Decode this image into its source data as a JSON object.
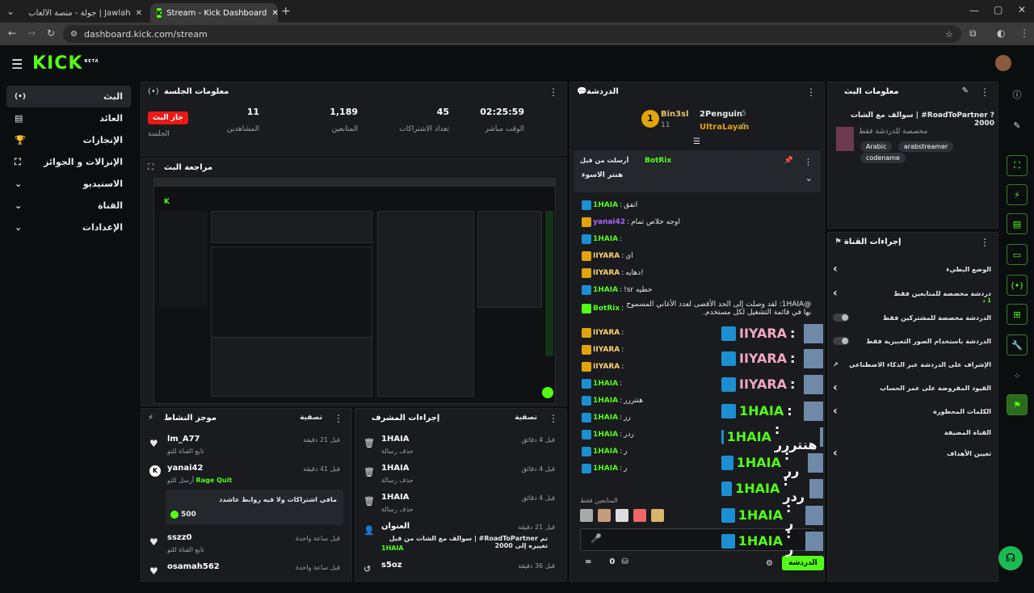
{
  "browser": {
    "tabs": [
      {
        "label": "Jawlah | جولة - منصة الألعاب الع",
        "active": false
      },
      {
        "label": "Stream - Kick Dashboard",
        "active": true
      }
    ],
    "url": "dashboard.kick.com/stream"
  },
  "logo": {
    "text": "KICK",
    "beta": "BETA"
  },
  "sidebar": {
    "items": [
      {
        "label": "البث",
        "icon": "live-icon",
        "active": true
      },
      {
        "label": "العائد",
        "icon": "wallet-icon",
        "active": false
      },
      {
        "label": "الإنجازات",
        "icon": "trophy-icon",
        "active": false
      },
      {
        "label": "الإنزالات و الجوائز",
        "icon": "drops-icon",
        "active": false
      },
      {
        "label": "الاستيديو",
        "icon": "studio-icon",
        "active": false
      },
      {
        "label": "القناة",
        "icon": "channel-icon",
        "active": false
      },
      {
        "label": "الإعدادات",
        "icon": "settings-icon",
        "active": false
      }
    ]
  },
  "session": {
    "title": "معلومات الجلسة",
    "live_badge": "جاز البث",
    "live_label": "الجلسة",
    "stats": [
      {
        "value": "02:25:59",
        "label": "الوقت مباشر"
      },
      {
        "value": "45",
        "label": "تعداد الاشتراكات"
      },
      {
        "value": "1,189",
        "label": "المتابعين"
      },
      {
        "value": "11",
        "label": "المشاهدين"
      }
    ]
  },
  "preview": {
    "title": "مراجعة البث"
  },
  "activity": {
    "title": "موجز النشاط",
    "filter": "تصفية",
    "items": [
      {
        "name": "lm_A77",
        "sub": "تابع القناة للتو",
        "time": "قبل 21 دقيقة"
      },
      {
        "name": "yanai42",
        "sub": "أرسل للتو",
        "highlight": "Rage Quit",
        "time": "قبل 41 دقيقة",
        "message": "مافي اشتراكات ولا فيه روابط عاشدد",
        "amount": "500"
      },
      {
        "name": "sszz0",
        "sub": "تابع القناة للتو",
        "time": "قبل ساعة واحدة"
      },
      {
        "name": "osamah562",
        "sub": "",
        "time": "قبل ساعة واحدة"
      }
    ]
  },
  "modactions": {
    "title": "إجراءات المشرف",
    "filter": "تصفية",
    "items": [
      {
        "name": "1HAIA",
        "sub": "حذف رسالة",
        "time": "قبل 4 دقائق"
      },
      {
        "name": "1HAIA",
        "sub": "حذف رسالة",
        "time": "قبل 4 دقائق"
      },
      {
        "name": "1HAIA",
        "sub": "حذف رسالة",
        "time": "قبل 4 دقائق"
      },
      {
        "name": "العنوان",
        "sub": "سوالف مع الشات من قبل | #RoadToPartner تم تغييره إلى 2000",
        "extra": "1HAIA",
        "time": "قبل 21 دقيقة"
      },
      {
        "name": "s5oz",
        "sub": "",
        "time": "قبل 36 دقيقة"
      }
    ]
  },
  "chat": {
    "title": "الدردشة",
    "leaders": [
      {
        "name": "Bin3sl",
        "count": "11",
        "rank": "1"
      },
      {
        "name": "2Penguin",
        "count": "5"
      },
      {
        "name": "UltraLayan",
        "count": "5"
      }
    ],
    "pinned": {
      "header": "أرسلت من قبل",
      "by": "BotRix",
      "text": "هنتر الاسوء"
    },
    "messages": [
      {
        "user": "1HAIA",
        "color": "#53fc18",
        "text": "اتفق"
      },
      {
        "user": "yanai42",
        "color": "#b263ff",
        "text": "اوجه خلاص تمام"
      },
      {
        "user": "1HAIA",
        "color": "#53fc18",
        "text": ""
      },
      {
        "user": "IIYARA",
        "color": "#ffd36a",
        "text": "اي"
      },
      {
        "user": "IIYARA",
        "color": "#ffd36a",
        "text": "دهايه!"
      },
      {
        "user": "1HAIA",
        "color": "#53fc18",
        "text": "!sr حطيه"
      },
      {
        "user": "BotRix",
        "color": "#53fc18",
        "text": "@1HAIA: لقد وصلت إلى الحد الأقصى لعدد الأغاني المسموح بها في قائمة التشغيل لكل مستخدم."
      },
      {
        "user": "IIYARA",
        "color": "#ffd36a",
        "text": ""
      },
      {
        "user": "IIYARA",
        "color": "#ffd36a",
        "text": ""
      },
      {
        "user": "IIYARA",
        "color": "#ffd36a",
        "text": ""
      },
      {
        "user": "1HAIA",
        "color": "#53fc18",
        "text": ""
      },
      {
        "user": "1HAIA",
        "color": "#53fc18",
        "text": "هنتررر"
      },
      {
        "user": "1HAIA",
        "color": "#53fc18",
        "text": "رر"
      },
      {
        "user": "1HAIA",
        "color": "#53fc18",
        "text": "ردر"
      },
      {
        "user": "1HAIA",
        "color": "#53fc18",
        "text": "ر"
      },
      {
        "user": "1HAIA",
        "color": "#53fc18",
        "text": "ر"
      }
    ],
    "followers_only": "المتابعين فقط",
    "send_label": "الدردشة",
    "count": "0"
  },
  "overlay": [
    {
      "user": "IIYARA",
      "text": ":"
    },
    {
      "user": "IIYARA",
      "text": ":"
    },
    {
      "user": "IIYARA",
      "text": ":"
    },
    {
      "user": "1HAIA",
      "text": ":"
    },
    {
      "user": "1HAIA",
      "text": ": هنتررر"
    },
    {
      "user": "1HAIA",
      "text": ": رر"
    },
    {
      "user": "1HAIA",
      "text": ": ردر"
    },
    {
      "user": "1HAIA",
      "text": ": ر"
    },
    {
      "user": "1HAIA",
      "text": ": ر"
    }
  ],
  "streaminfo": {
    "title": "معلومات البث",
    "stream_title": "سوالف مع الشات | #RoadToPartner ?2000",
    "subtitle": "مخصصة للدردشة فقط",
    "tags": [
      "Arabic",
      "arabstreamer",
      "codename"
    ]
  },
  "quickactions": {
    "title": "إجراءات القناة",
    "items": [
      {
        "label": "الوضع البطيء",
        "type": "chevron"
      },
      {
        "label": "دردشة مخصصة للمتابعين فقط",
        "sub": "1 د",
        "type": "chevron"
      },
      {
        "label": "الدردشة مخصصة للمشتركين فقط",
        "type": "toggle"
      },
      {
        "label": "الدردشة باستخدام الصور التعبيرية فقط",
        "type": "toggle"
      },
      {
        "label": "الإشراف على الدردشة عبر الذكاء الاصطناعي",
        "type": "external"
      },
      {
        "label": "القيود المفروضة على عمر الحساب",
        "type": "chevron"
      },
      {
        "label": "الكلمات المحظورة",
        "type": "chevron"
      },
      {
        "label": "القناة المضيفة",
        "type": "none"
      },
      {
        "label": "تعيين الأهداف",
        "type": "chevron"
      }
    ]
  }
}
